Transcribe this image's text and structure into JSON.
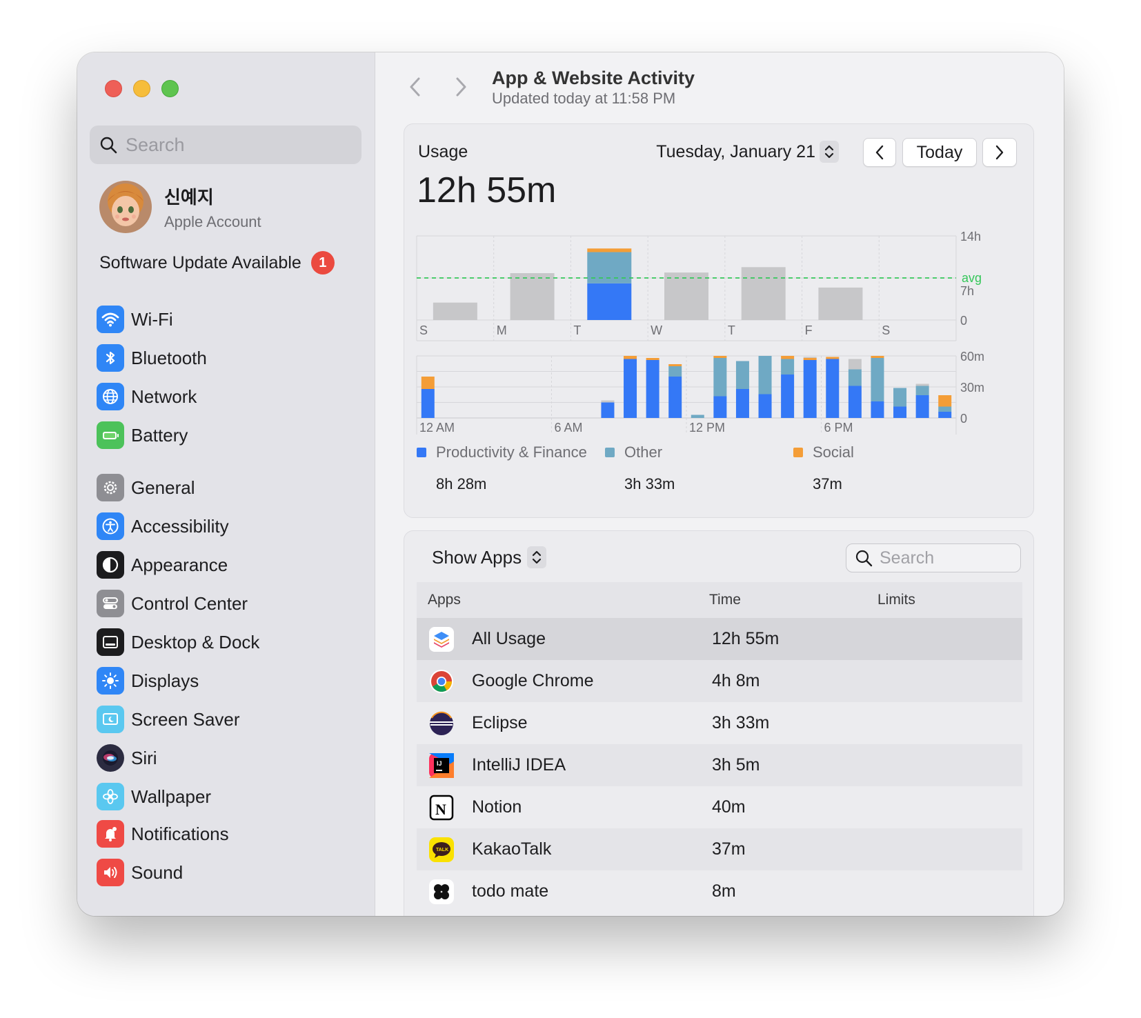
{
  "sidebar": {
    "search_placeholder": "Search",
    "account": {
      "name": "신예지",
      "subtitle": "Apple Account"
    },
    "update": {
      "label": "Software Update Available",
      "count": "1"
    },
    "groups": [
      [
        {
          "label": "Wi-Fi",
          "icon": "wifi-icon",
          "color": "#2f86f6"
        },
        {
          "label": "Bluetooth",
          "icon": "bluetooth-icon",
          "color": "#2f86f6"
        },
        {
          "label": "Network",
          "icon": "globe-icon",
          "color": "#2f86f6"
        },
        {
          "label": "Battery",
          "icon": "battery-icon",
          "color": "#4cc25a"
        }
      ],
      [
        {
          "label": "General",
          "icon": "gear-icon",
          "color": "#8e8e93"
        },
        {
          "label": "Accessibility",
          "icon": "accessibility-icon",
          "color": "#2f86f6"
        },
        {
          "label": "Appearance",
          "icon": "appearance-icon",
          "color": "#1c1c1e"
        },
        {
          "label": "Control Center",
          "icon": "control-center-icon",
          "color": "#8e8e93"
        },
        {
          "label": "Desktop & Dock",
          "icon": "dock-icon",
          "color": "#1c1c1e"
        },
        {
          "label": "Displays",
          "icon": "sun-icon",
          "color": "#2f86f6"
        },
        {
          "label": "Screen Saver",
          "icon": "screensaver-icon",
          "color": "#5ac8f0"
        },
        {
          "label": "Siri",
          "icon": "siri-icon",
          "color": "#2b2b40"
        },
        {
          "label": "Wallpaper",
          "icon": "wallpaper-icon",
          "color": "#5ac8f0"
        }
      ],
      [
        {
          "label": "Notifications",
          "icon": "bell-icon",
          "color": "#ef4a45"
        },
        {
          "label": "Sound",
          "icon": "speaker-icon",
          "color": "#ef4a45"
        }
      ]
    ]
  },
  "header": {
    "title": "App & Website Activity",
    "subtitle": "Updated today at 11:58 PM"
  },
  "usage": {
    "label": "Usage",
    "total": "12h 55m",
    "date": "Tuesday, January 21",
    "today_button": "Today"
  },
  "colors": {
    "productivity": "#3478f6",
    "other": "#6fa9c4",
    "social": "#f49d37",
    "past": "#c7c7c9",
    "avg": "#34c759"
  },
  "chart_data": [
    {
      "type": "bar",
      "categories": [
        "S",
        "M",
        "T",
        "W",
        "T",
        "F",
        "S"
      ],
      "series": [
        {
          "name": "Productivity & Finance",
          "values": [
            null,
            null,
            6.1,
            null,
            null,
            null,
            null
          ]
        },
        {
          "name": "Other",
          "values": [
            null,
            null,
            5.2,
            null,
            null,
            null,
            null
          ]
        },
        {
          "name": "Social",
          "values": [
            null,
            null,
            0.6,
            null,
            null,
            null,
            null
          ]
        },
        {
          "name": "",
          "values": [
            2.9,
            7.8,
            null,
            7.9,
            8.8,
            null,
            null
          ]
        }
      ],
      "past_values": [
        2.9,
        7.8,
        null,
        7.9,
        8.8,
        5.4,
        null
      ],
      "avg": 7.0,
      "avg_label": "avg",
      "y_ticks": [
        "14h",
        "7h",
        "0"
      ],
      "ylim": [
        0,
        14
      ],
      "grid": true
    },
    {
      "type": "bar",
      "categories": [
        "12 AM",
        "1",
        "2",
        "3",
        "4",
        "5",
        "6 AM",
        "7",
        "8",
        "9",
        "10",
        "11",
        "12 PM",
        "1",
        "2",
        "3",
        "4",
        "5",
        "6 PM",
        "7",
        "8",
        "9",
        "10",
        "11"
      ],
      "x_labels": [
        "12 AM",
        "6 AM",
        "12 PM",
        "6 PM"
      ],
      "series": [
        {
          "name": "Productivity & Finance",
          "values": [
            28,
            0,
            0,
            0,
            0,
            0,
            0,
            0,
            15,
            57,
            56,
            40,
            0,
            21,
            28,
            23,
            42,
            56,
            57,
            31,
            16,
            11,
            22,
            6
          ]
        },
        {
          "name": "Other",
          "values": [
            0,
            0,
            0,
            0,
            0,
            0,
            0,
            0,
            0,
            0,
            0,
            10,
            3,
            37,
            27,
            37,
            15,
            0,
            0,
            16,
            42,
            18,
            9,
            5
          ]
        },
        {
          "name": "Social",
          "values": [
            12,
            0,
            0,
            0,
            0,
            0,
            0,
            0,
            0,
            3,
            2,
            2,
            0,
            2,
            0,
            0,
            3,
            2,
            2,
            0,
            2,
            0,
            0,
            11
          ]
        },
        {
          "name": "",
          "values": [
            0,
            0,
            0,
            0,
            0,
            0,
            0,
            0,
            2,
            0,
            0,
            0,
            0,
            0,
            0,
            0,
            0,
            1,
            0,
            10,
            0,
            0,
            2,
            0
          ]
        }
      ],
      "y_ticks": [
        "60m",
        "30m",
        "0"
      ],
      "ylim": [
        0,
        60
      ],
      "grid": true
    }
  ],
  "legend": [
    {
      "name": "Productivity & Finance",
      "value": "8h 28m",
      "color": "#3478f6"
    },
    {
      "name": "Other",
      "value": "3h 33m",
      "color": "#6fa9c4"
    },
    {
      "name": "Social",
      "value": "37m",
      "color": "#f49d37"
    }
  ],
  "apps": {
    "show_label": "Show Apps",
    "search_placeholder": "Search",
    "columns": [
      "Apps",
      "Time",
      "Limits"
    ],
    "rows": [
      {
        "name": "All Usage",
        "time": "12h 55m",
        "icon": "stack-icon"
      },
      {
        "name": "Google Chrome",
        "time": "4h 8m",
        "icon": "chrome-icon"
      },
      {
        "name": "Eclipse",
        "time": "3h 33m",
        "icon": "eclipse-icon"
      },
      {
        "name": "IntelliJ IDEA",
        "time": "3h 5m",
        "icon": "intellij-icon"
      },
      {
        "name": "Notion",
        "time": "40m",
        "icon": "notion-icon"
      },
      {
        "name": "KakaoTalk",
        "time": "37m",
        "icon": "kakaotalk-icon"
      },
      {
        "name": "todo mate",
        "time": "8m",
        "icon": "todomate-icon"
      }
    ]
  }
}
